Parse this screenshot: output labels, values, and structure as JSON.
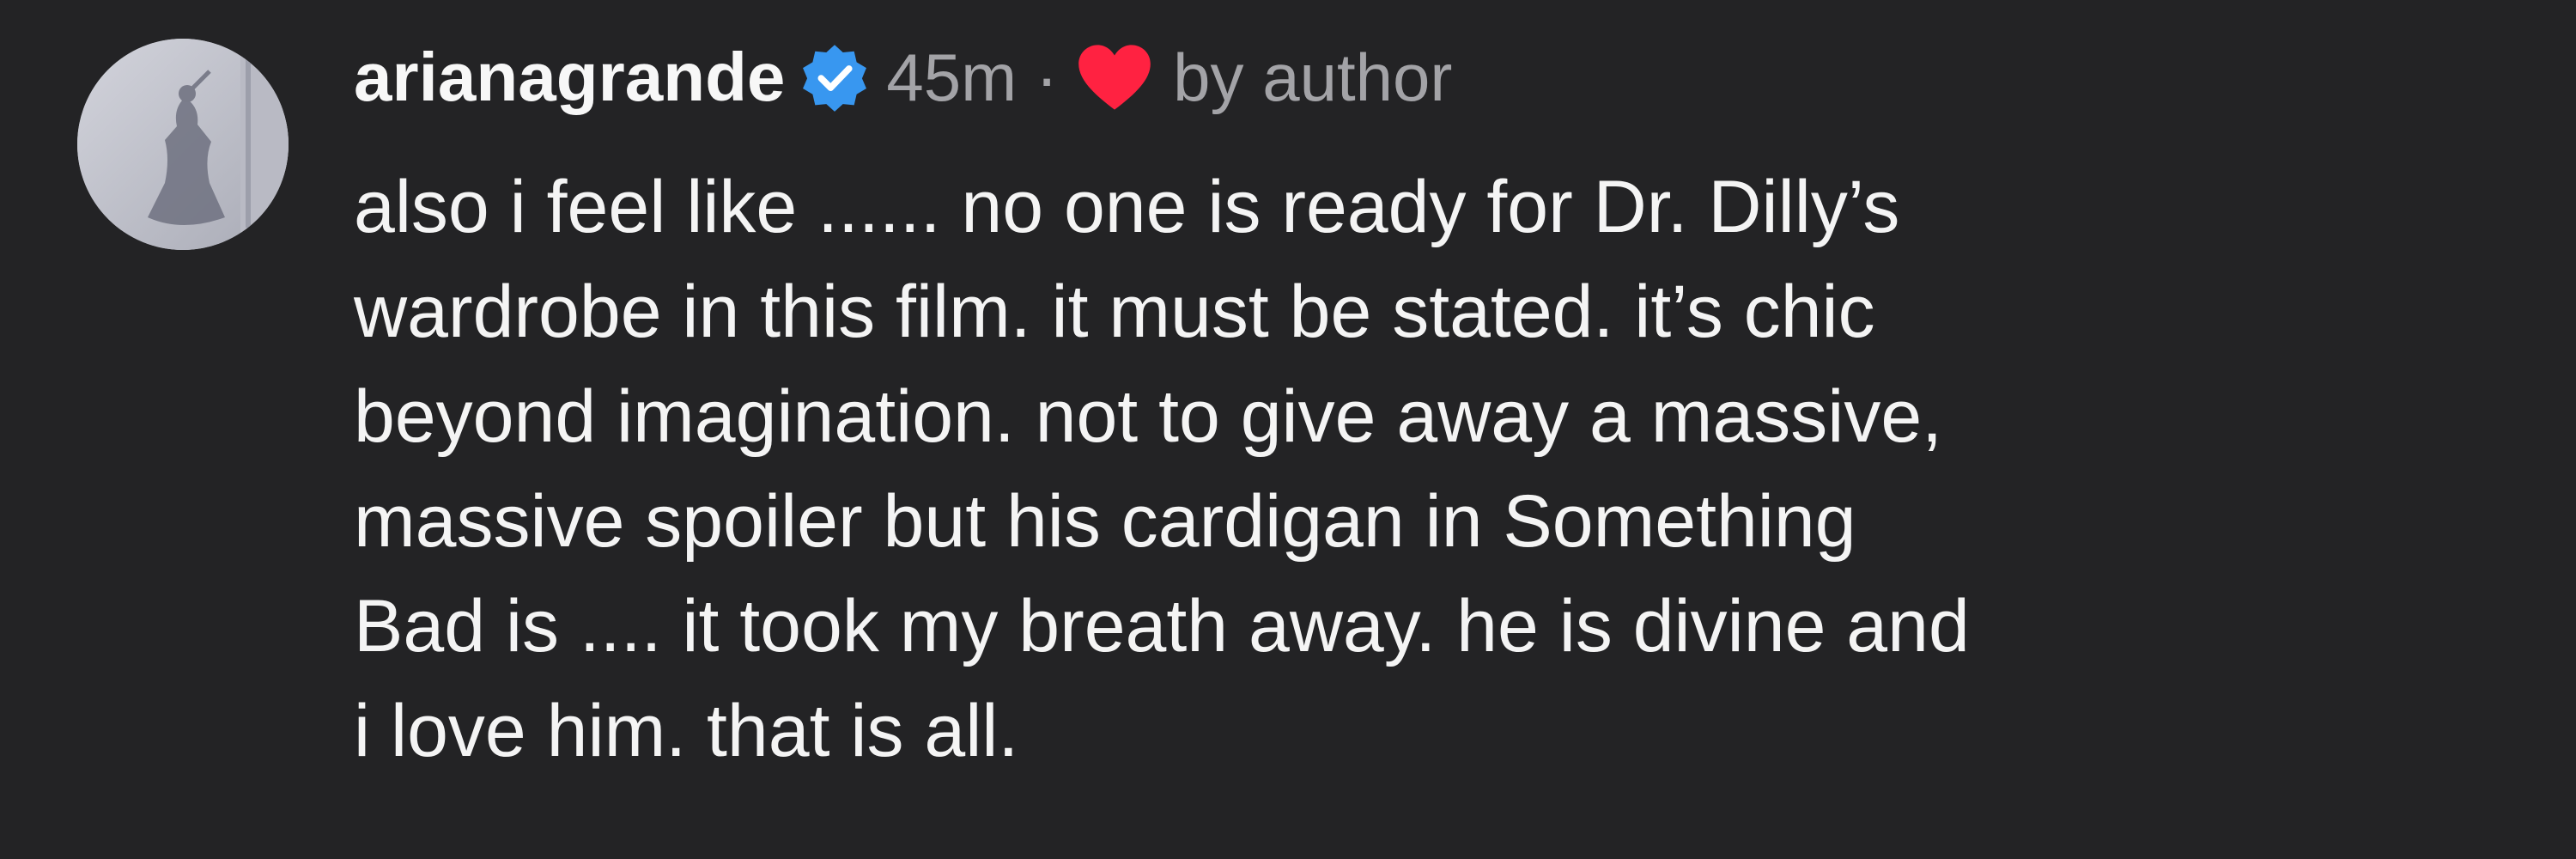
{
  "comment": {
    "avatar_icon": "profile-photo",
    "username": "arianagrande",
    "verified_icon": "verified-badge-icon",
    "verified_color": "#3897f0",
    "time": "45m",
    "separator": "·",
    "heart_icon": "heart-icon",
    "heart_color": "#ff3040",
    "liked_by": "by author",
    "lines": [
      "also i feel like ...... no one is ready for Dr. Dilly’s",
      "wardrobe in this film. it must be stated. it’s chic",
      "beyond imagination. not to give away a massive,",
      "massive spoiler but his cardigan in Something",
      "Bad is .... it took my breath away. he is divine and",
      "i love him. that is all."
    ]
  }
}
